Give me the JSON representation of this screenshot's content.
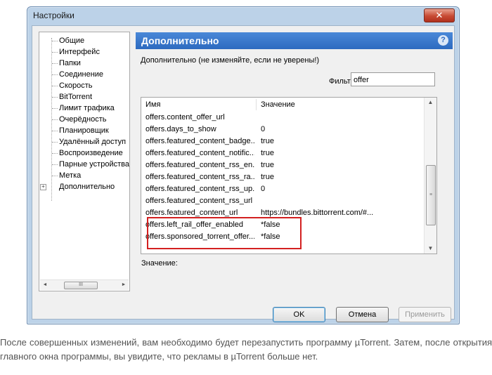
{
  "window": {
    "title": "Настройки",
    "close_glyph": "✕"
  },
  "tree": {
    "items": [
      {
        "label": "Общие"
      },
      {
        "label": "Интерфейс"
      },
      {
        "label": "Папки"
      },
      {
        "label": "Соединение"
      },
      {
        "label": "Скорость"
      },
      {
        "label": "BitTorrent"
      },
      {
        "label": "Лимит трафика"
      },
      {
        "label": "Очерёдность"
      },
      {
        "label": "Планировщик"
      },
      {
        "label": "Удалённый доступ"
      },
      {
        "label": "Воспроизведение"
      },
      {
        "label": "Парные устройства"
      },
      {
        "label": "Метка"
      },
      {
        "label": "Дополнительно"
      }
    ],
    "expander_glyph": "+",
    "scroll_left": "◄",
    "scroll_right": "►",
    "scroll_grip": "III"
  },
  "panel": {
    "header": "Дополнительно",
    "help_glyph": "?",
    "group_title": "Дополнительно (не изменяйте, если не уверены!)",
    "filter_label": "Фильтр",
    "filter_value": "offer",
    "columns": {
      "name": "Имя",
      "value": "Значение"
    },
    "rows": [
      {
        "name": "offers.content_offer_url",
        "value": ""
      },
      {
        "name": "offers.days_to_show",
        "value": "0"
      },
      {
        "name": "offers.featured_content_badge...",
        "value": "true"
      },
      {
        "name": "offers.featured_content_notific...",
        "value": "true"
      },
      {
        "name": "offers.featured_content_rss_en...",
        "value": "true"
      },
      {
        "name": "offers.featured_content_rss_ra...",
        "value": "true"
      },
      {
        "name": "offers.featured_content_rss_up...",
        "value": "0"
      },
      {
        "name": "offers.featured_content_rss_url",
        "value": ""
      },
      {
        "name": "offers.featured_content_url",
        "value": "https://bundles.bittorrent.com/#..."
      },
      {
        "name": "offers.left_rail_offer_enabled",
        "value": "*false"
      },
      {
        "name": "offers.sponsored_torrent_offer...",
        "value": "*false"
      }
    ],
    "scroll_up": "▲",
    "scroll_down": "▼",
    "scroll_grip": "≡",
    "value_label": "Значение:"
  },
  "buttons": {
    "ok": "OK",
    "cancel": "Отмена",
    "apply": "Применить"
  },
  "caption": "После совершенных изменений, вам необходимо будет перезапустить программу µTorrent. Затем, после открытия главного окна программы, вы увидите, что рекламы в µTorrent больше нет.",
  "colors": {
    "panel_header": "#2d6ac0",
    "highlight_box": "#d32020"
  }
}
